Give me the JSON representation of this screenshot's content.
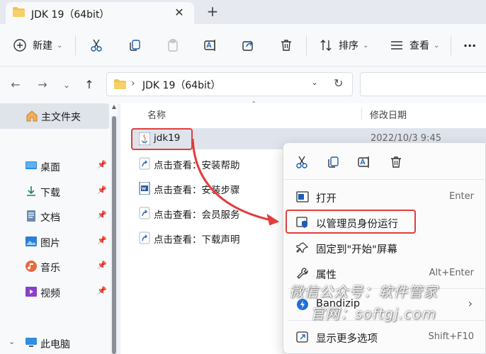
{
  "tab": {
    "title": "JDK 19（64bit）",
    "close": "✕",
    "new_tab": "+"
  },
  "toolbar": {
    "new_label": "新建",
    "sort_label": "排序",
    "view_label": "查看",
    "more": "···"
  },
  "address": {
    "separator": "›",
    "path": "JDK 19（64bit）"
  },
  "sidebar": {
    "home": "主文件夹",
    "items": [
      {
        "label": "桌面",
        "icon": "desktop-icon"
      },
      {
        "label": "下载",
        "icon": "download-icon"
      },
      {
        "label": "文档",
        "icon": "document-icon"
      },
      {
        "label": "图片",
        "icon": "picture-icon"
      },
      {
        "label": "音乐",
        "icon": "music-icon"
      },
      {
        "label": "视频",
        "icon": "video-icon"
      }
    ],
    "this_pc": "此电脑"
  },
  "columns": {
    "name": "名称",
    "modified": "修改日期"
  },
  "files": [
    {
      "name": "jdk19",
      "date": "2022/10/3 9:45",
      "selected": true
    },
    {
      "name": "点击查看：安装帮助",
      "date": ""
    },
    {
      "name": "点击查看：安装步骤",
      "date": ""
    },
    {
      "name": "点击查看：会员服务",
      "date": ""
    },
    {
      "name": "点击查看：下载声明",
      "date": ""
    }
  ],
  "context_menu": {
    "items": [
      {
        "label": "打开",
        "shortcut": "Enter"
      },
      {
        "label": "以管理员身份运行",
        "shortcut": ""
      },
      {
        "label": "固定到\"开始\"屏幕",
        "shortcut": ""
      },
      {
        "label": "属性",
        "shortcut": "Alt+Enter"
      },
      {
        "label": "Bandizip",
        "shortcut": ""
      },
      {
        "label": "显示更多选项",
        "shortcut": "Shift+F10"
      }
    ]
  },
  "watermark": {
    "line1": "微信公众号：软件管家",
    "line2": "官网：softgj.com"
  },
  "colors": {
    "accent": "#0067c0",
    "highlight": "#e23d3d",
    "folder": "#f2c14e"
  }
}
